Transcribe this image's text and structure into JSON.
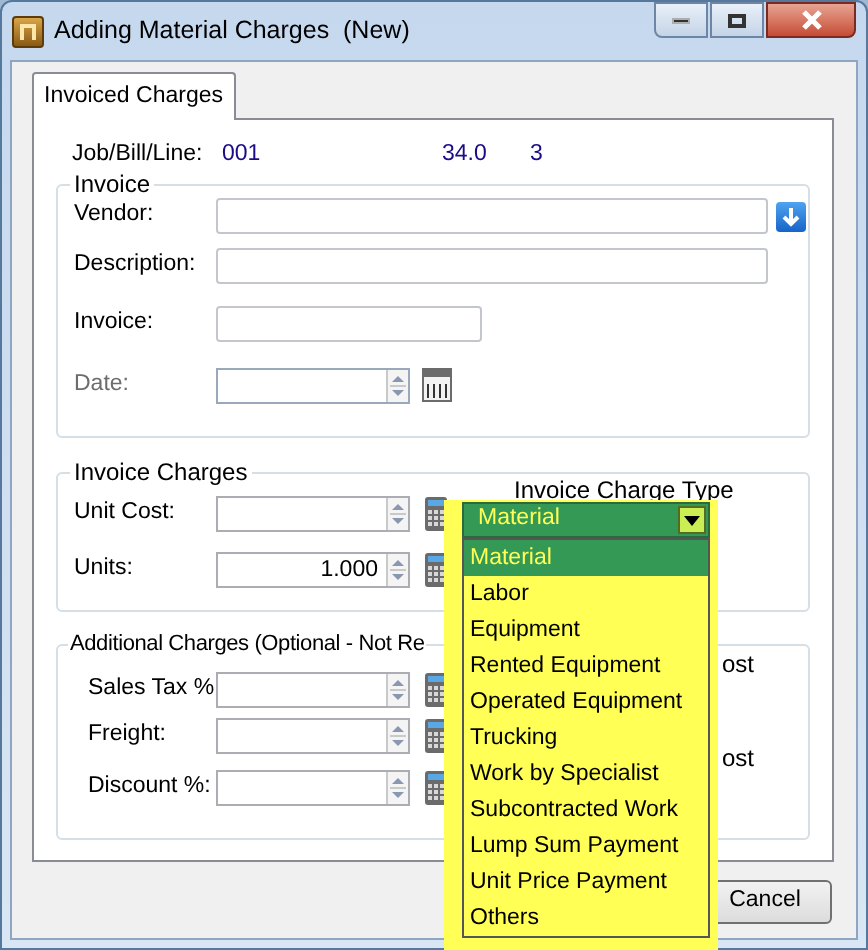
{
  "window": {
    "title": "Adding Material Charges  (New)"
  },
  "tabs": [
    {
      "label": "Invoiced Charges",
      "selected": true
    }
  ],
  "job_bill_line": {
    "label": "Job/Bill/Line:",
    "job": "001",
    "bill": "34.0",
    "line": "3"
  },
  "invoice_group": {
    "title": "Invoice",
    "fields": [
      {
        "kind": "lookup",
        "label": "Vendor:",
        "disabled": false
      },
      {
        "kind": "text",
        "label": "Description:",
        "disabled": false
      },
      {
        "kind": "short",
        "label": "Invoice:",
        "disabled": false
      },
      {
        "kind": "date",
        "label": "Date:",
        "disabled": true
      }
    ]
  },
  "invoice_charges_group": {
    "title": "Invoice Charges",
    "type_label": "Invoice Charge Type",
    "fields": [
      {
        "kind": "spin",
        "label": "Unit Cost:"
      },
      {
        "kind": "spin",
        "label": "Units:",
        "value": "1.000"
      }
    ]
  },
  "additional_group": {
    "title": "Additional Charges (Optional - Not Re",
    "fields": [
      {
        "kind": "spin",
        "label": "Sales Tax %"
      },
      {
        "kind": "spin",
        "label": "Freight:"
      },
      {
        "kind": "spin",
        "label": "Discount %:"
      }
    ],
    "partial_texts": [
      "ost",
      "ost"
    ]
  },
  "charge_type_dropdown": {
    "value": "Material",
    "options": [
      {
        "label": "Material",
        "selected": true
      },
      {
        "label": "Labor",
        "selected": false
      },
      {
        "label": "Equipment",
        "selected": false
      },
      {
        "label": "Rented Equipment",
        "selected": false
      },
      {
        "label": "Operated Equipment",
        "selected": false
      },
      {
        "label": "Trucking",
        "selected": false
      },
      {
        "label": "Work by Specialist",
        "selected": false
      },
      {
        "label": "Subcontracted Work",
        "selected": false
      },
      {
        "label": "Lump Sum Payment",
        "selected": false
      },
      {
        "label": "Unit Price Payment",
        "selected": false
      },
      {
        "label": "Others",
        "selected": false
      }
    ]
  },
  "buttons": [
    "Cancel"
  ]
}
